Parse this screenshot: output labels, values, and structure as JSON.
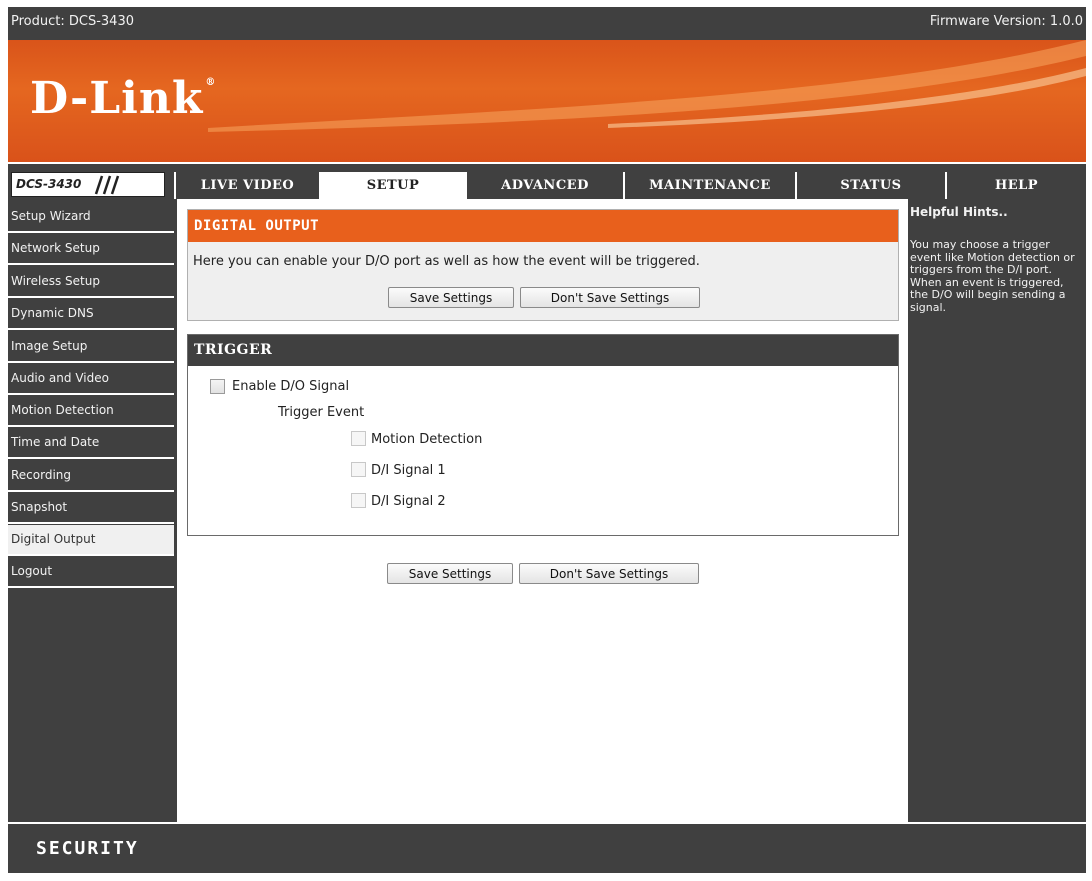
{
  "header": {
    "product": "Product: DCS-3430",
    "firmware": "Firmware Version: 1.0.0"
  },
  "brand": {
    "logo": "D-Link",
    "logo_mark": "®",
    "model": "DCS-3430"
  },
  "tabs": [
    {
      "label": "LIVE VIDEO",
      "active": false
    },
    {
      "label": "SETUP",
      "active": true
    },
    {
      "label": "ADVANCED",
      "active": false
    },
    {
      "label": "MAINTENANCE",
      "active": false
    },
    {
      "label": "STATUS",
      "active": false
    },
    {
      "label": "HELP",
      "active": false
    }
  ],
  "sidebar": {
    "items": [
      {
        "label": "Setup Wizard",
        "active": false
      },
      {
        "label": "Network Setup",
        "active": false
      },
      {
        "label": "Wireless Setup",
        "active": false
      },
      {
        "label": "Dynamic DNS",
        "active": false
      },
      {
        "label": "Image Setup",
        "active": false
      },
      {
        "label": "Audio and Video",
        "active": false
      },
      {
        "label": "Motion Detection",
        "active": false
      },
      {
        "label": "Time and Date",
        "active": false
      },
      {
        "label": "Recording",
        "active": false
      },
      {
        "label": "Snapshot",
        "active": false
      },
      {
        "label": "Digital Output",
        "active": true
      },
      {
        "label": "Logout",
        "active": false
      }
    ]
  },
  "digital_output": {
    "title": "DIGITAL OUTPUT",
    "description": "Here you can enable your D/O port as well as how the event will be triggered.",
    "save_label": "Save Settings",
    "dont_save_label": "Don't Save Settings"
  },
  "trigger": {
    "title": "TRIGGER",
    "enable_label": "Enable D/O Signal",
    "enable_checked": false,
    "event_label": "Trigger Event",
    "options": [
      {
        "label": "Motion Detection",
        "checked": false
      },
      {
        "label": "D/I Signal 1",
        "checked": false
      },
      {
        "label": "D/I Signal 2",
        "checked": false
      }
    ]
  },
  "bottom_buttons": {
    "save_label": "Save Settings",
    "dont_save_label": "Don't Save Settings"
  },
  "hints": {
    "title": "Helpful Hints..",
    "body": "You may choose a trigger event like Motion detection or triggers from the D/I port. When an event is triggered, the D/O will begin sending a signal."
  },
  "footer": {
    "label": "SECURITY"
  },
  "colors": {
    "accent_orange": "#e8601c",
    "dark_gray": "#404040"
  }
}
